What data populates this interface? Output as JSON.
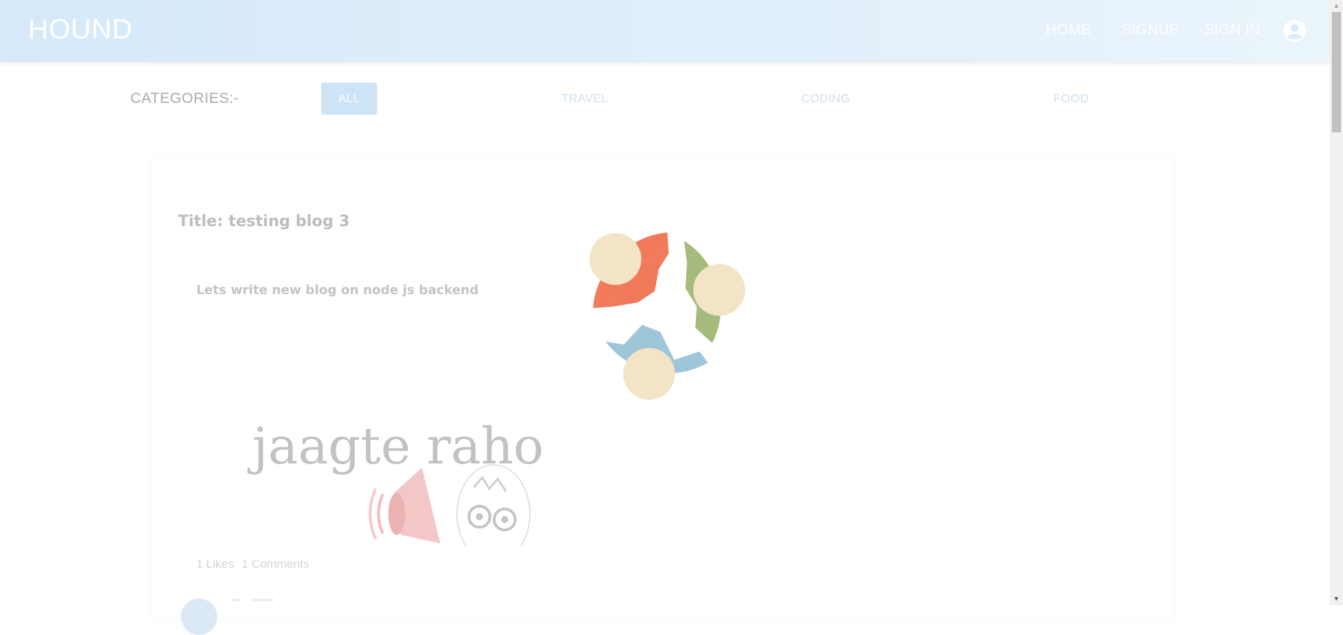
{
  "header": {
    "brand": "HOUND",
    "nav": {
      "home": "HOME",
      "signup": "SIGNUP",
      "signin": "SIGN IN"
    },
    "account_icon": "account-circle-icon"
  },
  "categories": {
    "label": "CATEGORIES:-",
    "items": [
      "ALL",
      "TRAVEL",
      "CODING",
      "FOOD"
    ],
    "selected": "ALL"
  },
  "post": {
    "title": "Title: testing blog 3",
    "description": "Lets write new blog on node js backend",
    "image_text": "jaagte raho",
    "likes": "1 Likes",
    "comments": "1 Comments"
  },
  "colors": {
    "navbar": "#d5e9fb",
    "selected_category": "#cde3f6",
    "loader_orange": "#f07a5a",
    "loader_green": "#a5bb7b",
    "loader_blue": "#9ec6d9",
    "loader_cream": "#f2e4c4"
  }
}
